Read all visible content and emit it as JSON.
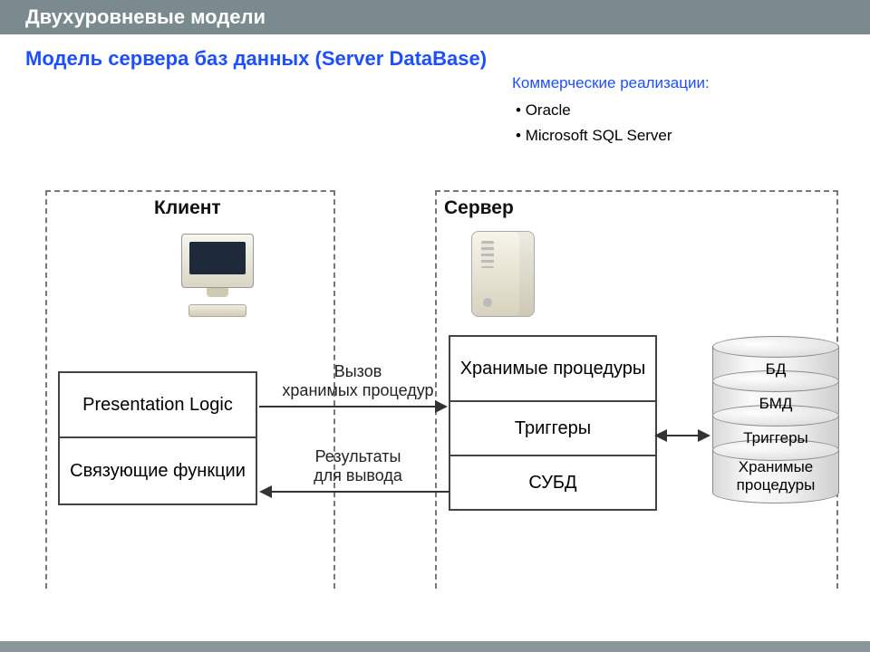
{
  "title": "Двухуровневые модели",
  "subtitle": "Модель сервера баз данных (Server DataBase)",
  "implementations": {
    "header": "Коммерческие реализации:",
    "items": [
      "Oracle",
      "Microsoft  SQL Server"
    ]
  },
  "client": {
    "title": "Клиент",
    "boxes": [
      "Presentation Logic",
      "Связующие функции"
    ]
  },
  "server": {
    "title": "Сервер",
    "boxes": [
      "Хранимые процедуры",
      "Триггеры",
      "СУБД"
    ]
  },
  "arrows": {
    "call": "Вызов\nхранимых процедур",
    "result": "Результаты\nдля вывода"
  },
  "cylinders": [
    "БД",
    "БМД",
    "Триггеры",
    "Хранимые процедуры"
  ]
}
